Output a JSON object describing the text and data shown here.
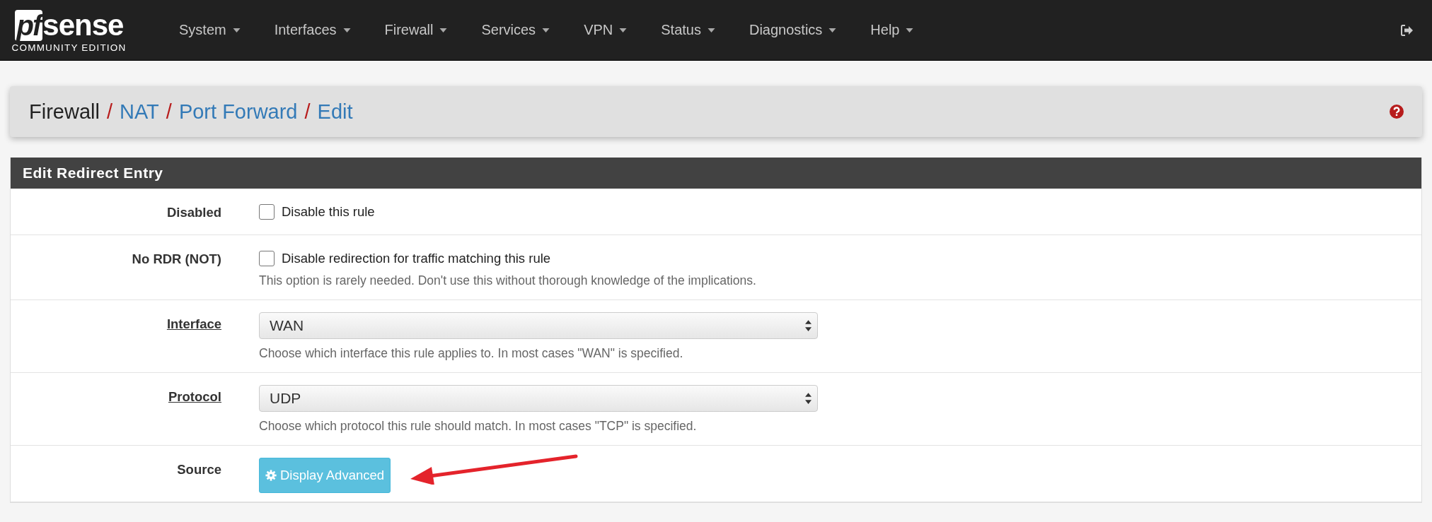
{
  "navbar": {
    "logo": {
      "mark": "pf",
      "word": "sense",
      "edition": "COMMUNITY EDITION"
    },
    "menus": [
      {
        "label": "System"
      },
      {
        "label": "Interfaces"
      },
      {
        "label": "Firewall"
      },
      {
        "label": "Services"
      },
      {
        "label": "VPN"
      },
      {
        "label": "Status"
      },
      {
        "label": "Diagnostics"
      },
      {
        "label": "Help"
      }
    ]
  },
  "breadcrumb": [
    {
      "label": "Firewall",
      "kind": "text"
    },
    {
      "separator": "/",
      "label": "NAT",
      "kind": "link"
    },
    {
      "separator": "/",
      "label": "Port Forward",
      "kind": "link"
    },
    {
      "separator": "/",
      "label": "Edit",
      "kind": "link"
    }
  ],
  "panel": {
    "title": "Edit Redirect Entry",
    "rows": [
      {
        "label": "Disabled",
        "label_link": false,
        "kind": "checkbox",
        "checked": false,
        "option": "Disable this rule"
      },
      {
        "label": "No RDR (NOT)",
        "label_link": false,
        "kind": "checkbox",
        "checked": false,
        "option": "Disable redirection for traffic matching this rule",
        "help": "This option is rarely needed. Don't use this without thorough knowledge of the implications."
      },
      {
        "label": "Interface",
        "label_link": true,
        "kind": "select",
        "value": "WAN",
        "help": "Choose which interface this rule applies to. In most cases \"WAN\" is specified."
      },
      {
        "label": "Protocol",
        "label_link": true,
        "kind": "select",
        "value": "UDP",
        "help": "Choose which protocol this rule should match. In most cases \"TCP\" is specified."
      },
      {
        "label": "Source",
        "label_link": false,
        "kind": "button",
        "button": "Display Advanced"
      }
    ]
  }
}
